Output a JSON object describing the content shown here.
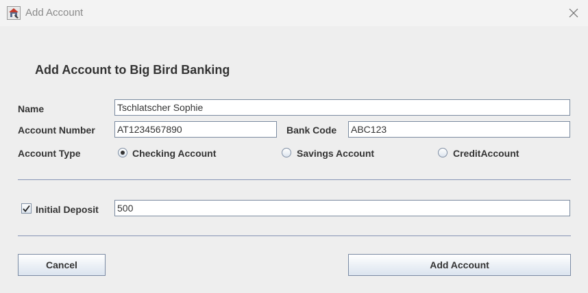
{
  "window": {
    "title": "Add Account",
    "close_icon": "close-icon",
    "app_icon": "java-app-icon"
  },
  "form": {
    "heading": "Add Account to Big Bird Banking",
    "name_label": "Name",
    "name_value": "Tschlatscher Sophie",
    "account_number_label": "Account Number",
    "account_number_value": "AT1234567890",
    "bank_code_label": "Bank Code",
    "bank_code_value": "ABC123",
    "account_type_label": "Account Type",
    "account_types": [
      {
        "label": "Checking Account",
        "selected": true
      },
      {
        "label": "Savings Account",
        "selected": false
      },
      {
        "label": "CreditAccount",
        "selected": false
      }
    ],
    "initial_deposit_label": "Initial Deposit",
    "initial_deposit_checked": true,
    "initial_deposit_value": "500"
  },
  "buttons": {
    "cancel_label": "Cancel",
    "add_label": "Add Account"
  },
  "colors": {
    "background": "#eeeeee",
    "separator": "#8593b4",
    "text": "#333333"
  }
}
